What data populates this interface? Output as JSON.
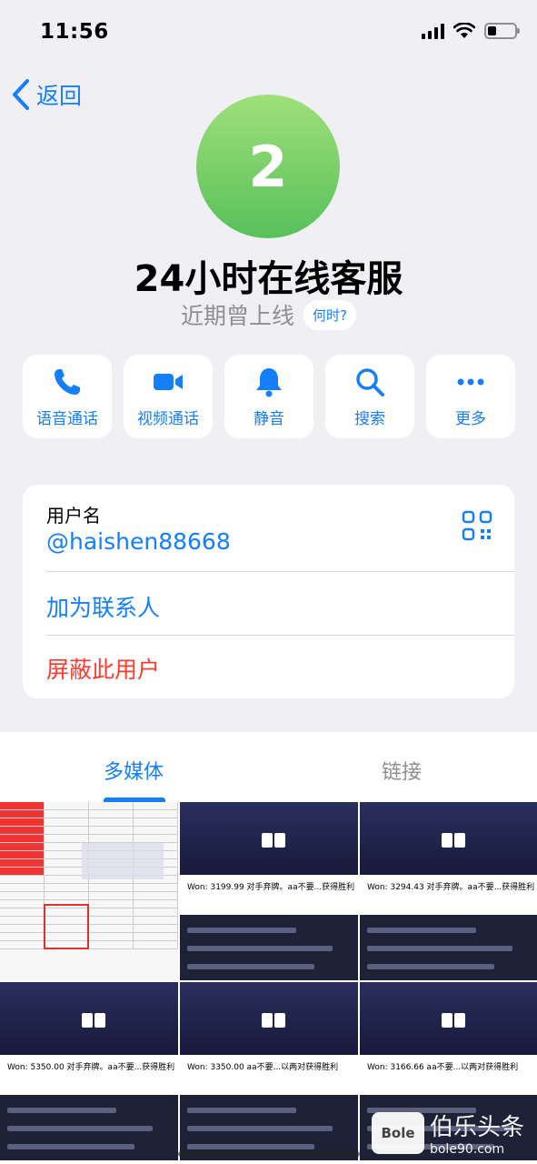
{
  "status_bar": {
    "time": "11:56"
  },
  "nav": {
    "back_label": "返回"
  },
  "profile": {
    "avatar_text": "2",
    "name": "24小时在线客服",
    "presence": "近期曾上线",
    "when_label": "何时?"
  },
  "actions": [
    {
      "label": "语音通话",
      "icon": "phone-icon"
    },
    {
      "label": "视频通话",
      "icon": "video-icon"
    },
    {
      "label": "静音",
      "icon": "bell-icon"
    },
    {
      "label": "搜索",
      "icon": "search-icon"
    },
    {
      "label": "更多",
      "icon": "more-icon"
    }
  ],
  "info": {
    "username_label": "用户名",
    "username": "@haishen88668",
    "add_contact": "加为联系人",
    "block_user": "屏蔽此用户"
  },
  "tabs": {
    "media": "多媒体",
    "links": "链接"
  },
  "media": {
    "won": [
      "Won: 3199.99  对手弃牌。aa不要...获得胜利",
      "Won: 3294.43  对手弃牌。aa不要...获得胜利",
      "Won: 5350.00  对手弃牌。aa不要...获得胜利",
      "Won: 3350.00  aa不要...以两对获得胜利",
      "Won: 3166.66  aa不要...以两对获得胜利"
    ]
  },
  "watermark": {
    "brand": "伯乐头条",
    "logo": "Bole",
    "site": "bole90.com"
  },
  "colors": {
    "accent": "#157efb",
    "danger": "#ff3b30",
    "avatar": "#6fcf5f"
  }
}
